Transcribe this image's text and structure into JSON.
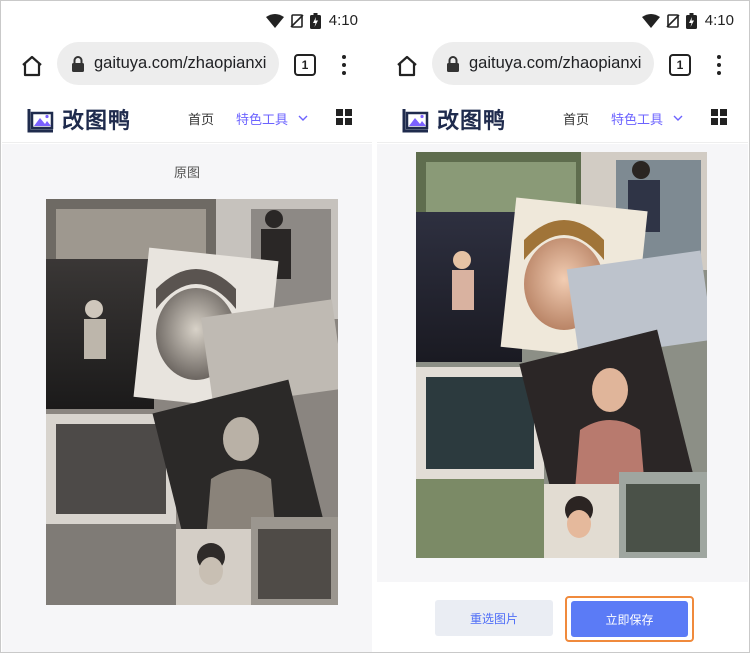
{
  "status": {
    "time": "4:10"
  },
  "browser": {
    "url": "gaituya.com/zhaopianxi",
    "tab_count": "1"
  },
  "site": {
    "logo_text": "改图鸭",
    "nav_home": "首页",
    "nav_tools": "特色工具"
  },
  "left_panel": {
    "caption": "原图"
  },
  "right_panel": {
    "reselect_label": "重选图片",
    "save_label": "立即保存"
  },
  "colors": {
    "accent": "#6c63ff",
    "save_button": "#5b7bf6",
    "highlight_border": "#f08a3c"
  }
}
